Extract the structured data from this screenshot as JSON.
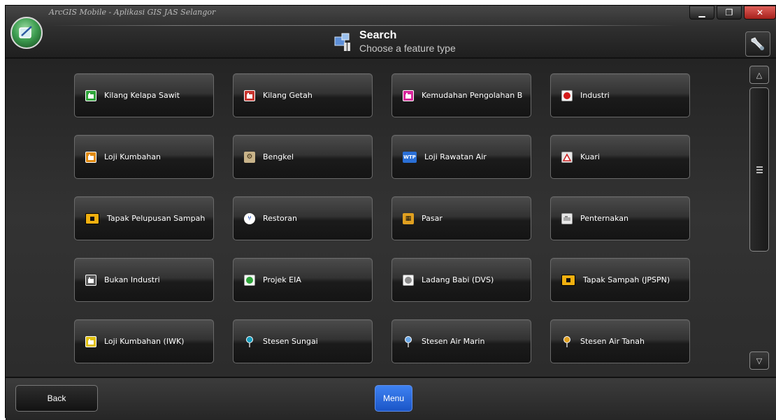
{
  "window": {
    "app_title": "ArcGIS Mobile - Aplikasi GIS JAS Selangor",
    "controls": [
      "minimize",
      "restore",
      "close"
    ]
  },
  "header": {
    "title": "Search",
    "subtitle": "Choose a feature type"
  },
  "features": [
    {
      "label": "Kilang Kelapa Sawit",
      "icon": "green-square-factory-icon",
      "color": "#2fa53a"
    },
    {
      "label": "Kilang Getah",
      "icon": "red-square-factory-icon",
      "color": "#c8352f"
    },
    {
      "label": "Kemudahan Pengolahan B",
      "icon": "magenta-square-factory-icon",
      "color": "#d8269b"
    },
    {
      "label": "Industri",
      "icon": "red-dot-icon",
      "color": "#d41a1a"
    },
    {
      "label": "Loji Kumbahan",
      "icon": "orange-square-factory-icon",
      "color": "#e08a10"
    },
    {
      "label": "Bengkel",
      "icon": "workshop-icon",
      "color": "#8a6a2a"
    },
    {
      "label": "Loji Rawatan Air",
      "icon": "wtp-icon",
      "color": "#2a6fd6"
    },
    {
      "label": "Kuari",
      "icon": "quarry-icon",
      "color": "#cc2222"
    },
    {
      "label": "Tapak Pelupusan Sampah",
      "icon": "landfill-icon",
      "color": "#f0b010"
    },
    {
      "label": "Restoran",
      "icon": "restaurant-icon",
      "color": "#3a63c8"
    },
    {
      "label": "Pasar",
      "icon": "market-icon",
      "color": "#e0a020"
    },
    {
      "label": "Penternakan",
      "icon": "farm-icon",
      "color": "#bdbdbd"
    },
    {
      "label": "Bukan Industri",
      "icon": "grey-square-factory-icon",
      "color": "#5a5a5a"
    },
    {
      "label": "Projek EIA",
      "icon": "eia-icon",
      "color": "#2ea33a"
    },
    {
      "label": "Ladang Babi (DVS)",
      "icon": "pig-farm-icon",
      "color": "#8a8a8a"
    },
    {
      "label": "Tapak Sampah (JPSPN)",
      "icon": "garbage-site-icon",
      "color": "#f0b010"
    },
    {
      "label": "Loji Kumbahan (IWK)",
      "icon": "yellow-square-factory-icon",
      "color": "#e0c010"
    },
    {
      "label": "Stesen Sungai",
      "icon": "teal-pin-icon",
      "color": "#1aa0c0"
    },
    {
      "label": "Stesen Air Marin",
      "icon": "lightblue-pin-icon",
      "color": "#6aa8e8"
    },
    {
      "label": "Stesen Air Tanah",
      "icon": "orange-pin-icon",
      "color": "#e0a020"
    }
  ],
  "footer": {
    "back_label": "Back",
    "menu_label": "Menu"
  },
  "colors": {
    "accent": "#2a6fe0",
    "background": "#2b2b2b"
  }
}
